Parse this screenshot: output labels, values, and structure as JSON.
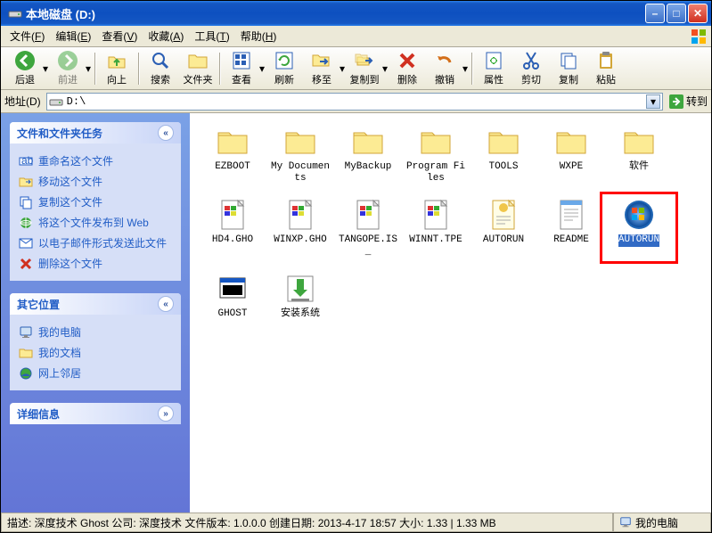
{
  "title": "本地磁盘 (D:)",
  "menu": [
    "文件(F)",
    "编辑(E)",
    "查看(V)",
    "收藏(A)",
    "工具(T)",
    "帮助(H)"
  ],
  "toolbar": [
    {
      "id": "back",
      "label": "后退",
      "disabled": false,
      "dropdown": true,
      "color": "#3ea63e"
    },
    {
      "id": "forward",
      "label": "前进",
      "disabled": true,
      "dropdown": true,
      "color": "#3ea63e"
    },
    {
      "id": "sep"
    },
    {
      "id": "up",
      "label": "向上",
      "color": "#3ea63e"
    },
    {
      "id": "sep"
    },
    {
      "id": "search",
      "label": "搜索",
      "color": "#2b5fb4"
    },
    {
      "id": "folders",
      "label": "文件夹",
      "color": "#f0c64a"
    },
    {
      "id": "sep"
    },
    {
      "id": "views",
      "label": "查看",
      "dropdown": true,
      "color": "#2b5fb4"
    },
    {
      "id": "refresh",
      "label": "刷新",
      "color": "#2b5fb4"
    },
    {
      "id": "moveto",
      "label": "移至",
      "dropdown": true,
      "color": "#2b5fb4"
    },
    {
      "id": "copyto",
      "label": "复制到",
      "dropdown": true,
      "color": "#2b5fb4"
    },
    {
      "id": "delete",
      "label": "删除",
      "color": "#d03020"
    },
    {
      "id": "undo",
      "label": "撤销",
      "dropdown": true,
      "color": "#d36f1a"
    },
    {
      "id": "sep"
    },
    {
      "id": "properties",
      "label": "属性",
      "color": "#2b5fb4"
    },
    {
      "id": "cut",
      "label": "剪切",
      "color": "#2b5fb4"
    },
    {
      "id": "copy",
      "label": "复制",
      "color": "#2b5fb4"
    },
    {
      "id": "paste",
      "label": "粘贴",
      "color": "#2b5fb4"
    }
  ],
  "address": {
    "label": "地址(D)",
    "value": "D:\\",
    "go": "转到"
  },
  "sidebar": {
    "tasks": {
      "title": "文件和文件夹任务",
      "items": [
        {
          "icon": "rename",
          "label": "重命名这个文件"
        },
        {
          "icon": "move",
          "label": "移动这个文件"
        },
        {
          "icon": "copy",
          "label": "复制这个文件"
        },
        {
          "icon": "web",
          "label": "将这个文件发布到 Web"
        },
        {
          "icon": "email",
          "label": "以电子邮件形式发送此文件"
        },
        {
          "icon": "delete",
          "label": "删除这个文件"
        }
      ]
    },
    "places": {
      "title": "其它位置",
      "items": [
        {
          "icon": "mycomputer",
          "label": "我的电脑"
        },
        {
          "icon": "mydocs",
          "label": "我的文档"
        },
        {
          "icon": "network",
          "label": "网上邻居"
        }
      ]
    },
    "details": {
      "title": "详细信息"
    }
  },
  "files": [
    {
      "name": "EZBOOT",
      "type": "folder"
    },
    {
      "name": "My Documents",
      "type": "folder"
    },
    {
      "name": "MyBackup",
      "type": "folder"
    },
    {
      "name": "Program Files",
      "type": "folder"
    },
    {
      "name": "TOOLS",
      "type": "folder"
    },
    {
      "name": "WXPE",
      "type": "folder"
    },
    {
      "name": "软件",
      "type": "folder"
    },
    {
      "name": "HD4.GHO",
      "type": "gho"
    },
    {
      "name": "WINXP.GHO",
      "type": "gho"
    },
    {
      "name": "TANGOPE.IS_",
      "type": "gho"
    },
    {
      "name": "WINNT.TPE",
      "type": "gho"
    },
    {
      "name": "AUTORUN",
      "type": "inf"
    },
    {
      "name": "README",
      "type": "txt"
    },
    {
      "name": "AUTORUN",
      "type": "exe",
      "selected": true,
      "highlight": true
    },
    {
      "name": "GHOST",
      "type": "app"
    },
    {
      "name": "安装系统",
      "type": "install"
    }
  ],
  "status": {
    "description": "描述: 深度技术 Ghost 公司: 深度技术 文件版本: 1.0.0.0 创建日期: 2013-4-17 18:57 大小: 1.33 | 1.33 MB",
    "location": "我的电脑"
  }
}
